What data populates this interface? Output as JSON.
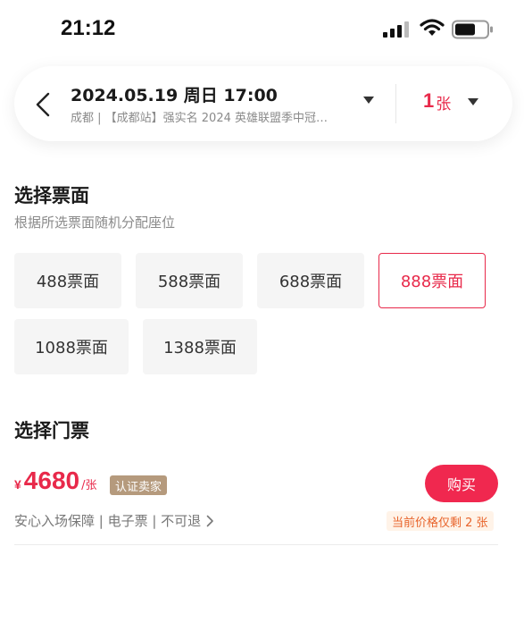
{
  "status_bar": {
    "time": "21:12"
  },
  "header": {
    "event_datetime": "2024.05.19 周日 17:00",
    "event_subtitle": "成都 | 【成都站】强实名 2024 英雄联盟季中冠…",
    "quantity": "1",
    "quantity_unit": "张"
  },
  "tier_section": {
    "title": "选择票面",
    "subtitle": "根据所选票面随机分配座位",
    "tiers": [
      {
        "label": "488票面",
        "selected": false
      },
      {
        "label": "588票面",
        "selected": false
      },
      {
        "label": "688票面",
        "selected": false
      },
      {
        "label": "888票面",
        "selected": true
      },
      {
        "label": "1088票面",
        "selected": false
      },
      {
        "label": "1388票面",
        "selected": false
      }
    ]
  },
  "ticket_section": {
    "title": "选择门票",
    "currency": "¥",
    "price": "4680",
    "price_unit": "/张",
    "seller_badge": "认证卖家",
    "buy_label": "购买",
    "features": "安心入场保障 | 电子票 | 不可退",
    "stock_note": "当前价格仅剩 2 张"
  },
  "colors": {
    "accent": "#e8294a",
    "buy_button": "#f0284f",
    "seller_badge": "#b59a7d",
    "stock_text": "#e8632a",
    "stock_bg": "#fff3e8"
  },
  "icons": {
    "back": "back-arrow-icon",
    "dropdown": "caret-down-icon",
    "chevron": "chevron-right-icon",
    "signal": "signal-icon",
    "wifi": "wifi-icon",
    "battery": "battery-icon"
  }
}
